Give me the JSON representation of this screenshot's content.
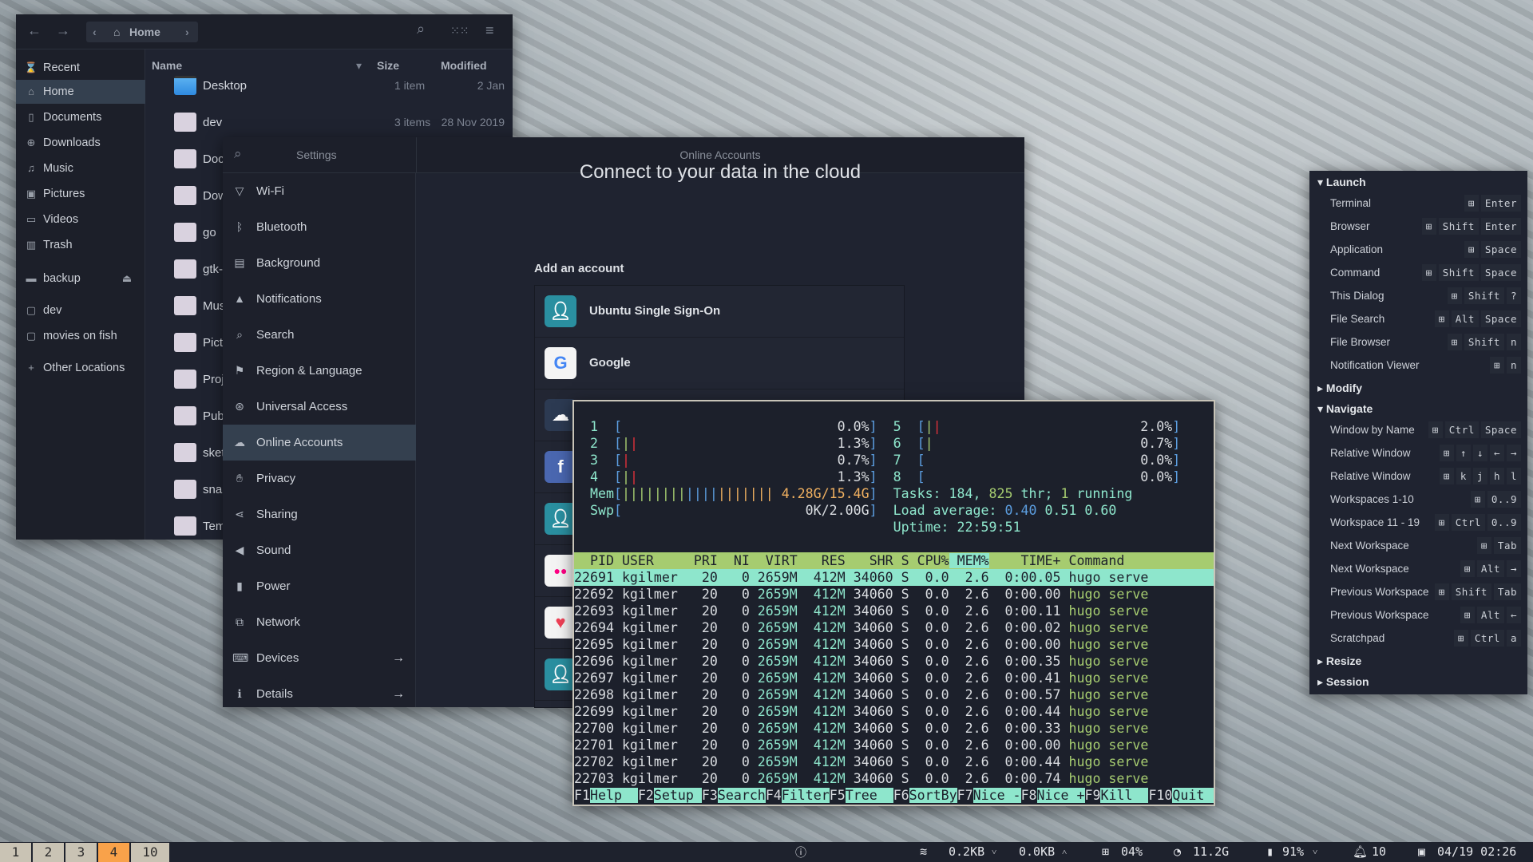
{
  "file_manager": {
    "breadcrumb": "Home",
    "sidebar": [
      {
        "label": "Recent",
        "icon": "recent-icon",
        "selected": false
      },
      {
        "label": "Home",
        "icon": "home-icon",
        "selected": true
      },
      {
        "label": "Documents",
        "icon": "document-icon",
        "selected": false
      },
      {
        "label": "Downloads",
        "icon": "download-icon",
        "selected": false
      },
      {
        "label": "Music",
        "icon": "music-icon",
        "selected": false
      },
      {
        "label": "Pictures",
        "icon": "picture-icon",
        "selected": false
      },
      {
        "label": "Videos",
        "icon": "video-icon",
        "selected": false
      },
      {
        "label": "Trash",
        "icon": "trash-icon",
        "selected": false
      },
      {
        "label": "backup",
        "icon": "drive-icon",
        "selected": false,
        "eject": true
      },
      {
        "label": "dev",
        "icon": "network-folder-icon",
        "selected": false
      },
      {
        "label": "movies on fish",
        "icon": "network-folder-icon",
        "selected": false
      },
      {
        "label": "Other Locations",
        "icon": "plus-icon",
        "selected": false
      }
    ],
    "columns": {
      "name": "Name",
      "size": "Size",
      "modified": "Modified"
    },
    "files": [
      {
        "name": "Desktop",
        "size": "1 item",
        "modified": "2 Jan",
        "special": true
      },
      {
        "name": "dev",
        "size": "3 items",
        "modified": "28 Nov 2019"
      },
      {
        "name": "Docum"
      },
      {
        "name": "Downl"
      },
      {
        "name": "go"
      },
      {
        "name": "gtk-fo"
      },
      {
        "name": "Music"
      },
      {
        "name": "Picture"
      },
      {
        "name": "Projec"
      },
      {
        "name": "Public"
      },
      {
        "name": "sketch"
      },
      {
        "name": "snap"
      },
      {
        "name": "Templa"
      }
    ]
  },
  "settings": {
    "title": "Settings",
    "panel_title": "Online Accounts",
    "items": [
      {
        "label": "Wi-Fi",
        "icon": "wifi-icon"
      },
      {
        "label": "Bluetooth",
        "icon": "bluetooth-icon"
      },
      {
        "label": "Background",
        "icon": "background-icon"
      },
      {
        "label": "Notifications",
        "icon": "bell-icon"
      },
      {
        "label": "Search",
        "icon": "search-icon"
      },
      {
        "label": "Region & Language",
        "icon": "region-icon"
      },
      {
        "label": "Universal Access",
        "icon": "accessibility-icon"
      },
      {
        "label": "Online Accounts",
        "icon": "online-accounts-icon",
        "selected": true
      },
      {
        "label": "Privacy",
        "icon": "hand-icon"
      },
      {
        "label": "Sharing",
        "icon": "share-icon"
      },
      {
        "label": "Sound",
        "icon": "speaker-icon"
      },
      {
        "label": "Power",
        "icon": "battery-icon"
      },
      {
        "label": "Network",
        "icon": "network-icon"
      },
      {
        "label": "Devices",
        "icon": "devices-icon",
        "arrow": true
      },
      {
        "label": "Details",
        "icon": "info-icon",
        "arrow": true
      }
    ],
    "heading": "Connect to your data in the cloud",
    "add_label": "Add an account",
    "accounts": [
      {
        "label": "Ubuntu Single Sign-On",
        "icon": "user-icon",
        "color": "#2a8fa0"
      },
      {
        "label": "Google",
        "icon": "google-icon",
        "color": "#f4f4f4"
      },
      {
        "label": "",
        "icon": "owncloud-icon",
        "color": "#2c3a52"
      },
      {
        "label": "",
        "icon": "facebook-icon",
        "color": "#4a67b0"
      },
      {
        "label": "",
        "icon": "user-icon",
        "color": "#2a8fa0"
      },
      {
        "label": "",
        "icon": "flickr-icon",
        "color": "#f4f4f4"
      },
      {
        "label": "",
        "icon": "pocket-icon",
        "color": "#f4f4f4"
      },
      {
        "label": "",
        "icon": "user-icon",
        "color": "#2a8fa0"
      }
    ]
  },
  "htop": {
    "cpus": [
      {
        "id": "1",
        "percent": "0.0%",
        "normal": 0,
        "kernel": 0
      },
      {
        "id": "2",
        "percent": "1.3%",
        "normal": 1,
        "kernel": 1
      },
      {
        "id": "3",
        "percent": "0.7%",
        "normal": 0,
        "kernel": 1
      },
      {
        "id": "4",
        "percent": "1.3%",
        "normal": 1,
        "kernel": 1
      },
      {
        "id": "5",
        "percent": "2.0%",
        "normal": 1,
        "kernel": 1
      },
      {
        "id": "6",
        "percent": "0.7%",
        "normal": 1,
        "kernel": 0
      },
      {
        "id": "7",
        "percent": "0.0%",
        "normal": 0,
        "kernel": 0
      },
      {
        "id": "8",
        "percent": "0.0%",
        "normal": 0,
        "kernel": 0
      }
    ],
    "mem": {
      "label": "Mem",
      "value": "4.28G/15.4G",
      "used": 8,
      "buffers": 4,
      "cache": 7
    },
    "swp": {
      "label": "Swp",
      "value": "0K/2.00G"
    },
    "tasks": {
      "label": "Tasks: ",
      "count": "184",
      "threads": "825",
      "thr_label": " thr; ",
      "running": "1",
      "running_label": " running"
    },
    "load": {
      "label": "Load average: ",
      "v1": "0.40",
      "v5": "0.51",
      "v15": "0.60"
    },
    "uptime": {
      "label": "Uptime: ",
      "value": "22:59:51"
    },
    "headers": [
      "PID",
      "USER",
      "PRI",
      "NI",
      "VIRT",
      "RES",
      "SHR",
      "S",
      "CPU%",
      "MEM%",
      "TIME+",
      "Command"
    ],
    "sorted_column": "MEM%",
    "selected_pid": "22691",
    "processes": [
      [
        "22691",
        "kgilmer",
        "20",
        "0",
        "2659M",
        "412M",
        "34060",
        "S",
        "0.0",
        "2.6",
        "0:00.05",
        "hugo serve"
      ],
      [
        "22692",
        "kgilmer",
        "20",
        "0",
        "2659M",
        "412M",
        "34060",
        "S",
        "0.0",
        "2.6",
        "0:00.00",
        "hugo serve"
      ],
      [
        "22693",
        "kgilmer",
        "20",
        "0",
        "2659M",
        "412M",
        "34060",
        "S",
        "0.0",
        "2.6",
        "0:00.11",
        "hugo serve"
      ],
      [
        "22694",
        "kgilmer",
        "20",
        "0",
        "2659M",
        "412M",
        "34060",
        "S",
        "0.0",
        "2.6",
        "0:00.02",
        "hugo serve"
      ],
      [
        "22695",
        "kgilmer",
        "20",
        "0",
        "2659M",
        "412M",
        "34060",
        "S",
        "0.0",
        "2.6",
        "0:00.00",
        "hugo serve"
      ],
      [
        "22696",
        "kgilmer",
        "20",
        "0",
        "2659M",
        "412M",
        "34060",
        "S",
        "0.0",
        "2.6",
        "0:00.35",
        "hugo serve"
      ],
      [
        "22697",
        "kgilmer",
        "20",
        "0",
        "2659M",
        "412M",
        "34060",
        "S",
        "0.0",
        "2.6",
        "0:00.41",
        "hugo serve"
      ],
      [
        "22698",
        "kgilmer",
        "20",
        "0",
        "2659M",
        "412M",
        "34060",
        "S",
        "0.0",
        "2.6",
        "0:00.57",
        "hugo serve"
      ],
      [
        "22699",
        "kgilmer",
        "20",
        "0",
        "2659M",
        "412M",
        "34060",
        "S",
        "0.0",
        "2.6",
        "0:00.44",
        "hugo serve"
      ],
      [
        "22700",
        "kgilmer",
        "20",
        "0",
        "2659M",
        "412M",
        "34060",
        "S",
        "0.0",
        "2.6",
        "0:00.33",
        "hugo serve"
      ],
      [
        "22701",
        "kgilmer",
        "20",
        "0",
        "2659M",
        "412M",
        "34060",
        "S",
        "0.0",
        "2.6",
        "0:00.00",
        "hugo serve"
      ],
      [
        "22702",
        "kgilmer",
        "20",
        "0",
        "2659M",
        "412M",
        "34060",
        "S",
        "0.0",
        "2.6",
        "0:00.44",
        "hugo serve"
      ],
      [
        "22703",
        "kgilmer",
        "20",
        "0",
        "2659M",
        "412M",
        "34060",
        "S",
        "0.0",
        "2.6",
        "0:00.74",
        "hugo serve"
      ]
    ],
    "footer": [
      [
        "F1",
        "Help"
      ],
      [
        "F2",
        "Setup"
      ],
      [
        "F3",
        "Search"
      ],
      [
        "F4",
        "Filter"
      ],
      [
        "F5",
        "Tree"
      ],
      [
        "F6",
        "SortBy"
      ],
      [
        "F7",
        "Nice -"
      ],
      [
        "F8",
        "Nice +"
      ],
      [
        "F9",
        "Kill"
      ],
      [
        "F10",
        "Quit"
      ]
    ]
  },
  "keybindings": {
    "super_icon": "windows-key-icon",
    "sections": [
      {
        "title": "Launch",
        "expanded": true,
        "items": [
          {
            "label": "Terminal",
            "keys": [
              "Enter"
            ]
          },
          {
            "label": "Browser",
            "keys": [
              "Shift",
              "Enter"
            ]
          },
          {
            "label": "Application",
            "keys": [
              "Space"
            ]
          },
          {
            "label": "Command",
            "keys": [
              "Shift",
              "Space"
            ]
          },
          {
            "label": "This Dialog",
            "keys": [
              "Shift",
              "?"
            ]
          },
          {
            "label": "File Search",
            "keys": [
              "Alt",
              "Space"
            ]
          },
          {
            "label": "File Browser",
            "keys": [
              "Shift",
              "n"
            ]
          },
          {
            "label": "Notification Viewer",
            "keys": [
              "n"
            ]
          }
        ]
      },
      {
        "title": "Modify",
        "expanded": false,
        "items": []
      },
      {
        "title": "Navigate",
        "expanded": true,
        "items": [
          {
            "label": "Window by Name",
            "keys": [
              "Ctrl",
              "Space"
            ]
          },
          {
            "label": "Relative Window",
            "keys": [
              "↑",
              "↓",
              "←",
              "→"
            ]
          },
          {
            "label": "Relative Window",
            "keys": [
              "k",
              "j",
              "h",
              "l"
            ]
          },
          {
            "label": "Workspaces 1-10",
            "keys": [
              "0..9"
            ]
          },
          {
            "label": "Workspace 11 - 19",
            "keys": [
              "Ctrl",
              "0..9"
            ]
          },
          {
            "label": "Next Workspace",
            "keys": [
              "Tab"
            ]
          },
          {
            "label": "Next Workspace",
            "keys": [
              "Alt",
              "→"
            ]
          },
          {
            "label": "Previous Workspace",
            "keys": [
              "Shift",
              "Tab"
            ]
          },
          {
            "label": "Previous Workspace",
            "keys": [
              "Alt",
              "←"
            ]
          },
          {
            "label": "Scratchpad",
            "keys": [
              "Ctrl",
              "a"
            ]
          }
        ]
      },
      {
        "title": "Resize",
        "expanded": false,
        "items": []
      },
      {
        "title": "Session",
        "expanded": false,
        "items": []
      }
    ]
  },
  "bar": {
    "workspaces": [
      {
        "label": "1"
      },
      {
        "label": "2"
      },
      {
        "label": "3"
      },
      {
        "label": "4",
        "active": true
      },
      {
        "label": "10"
      }
    ],
    "active_color": "#f9a24a",
    "net_down": "0.2KB",
    "net_up": "0.0KB",
    "cpu": "04%",
    "memory": "11.2G",
    "battery": "91%",
    "notifications": "10",
    "datetime": "04/19 02:26"
  }
}
